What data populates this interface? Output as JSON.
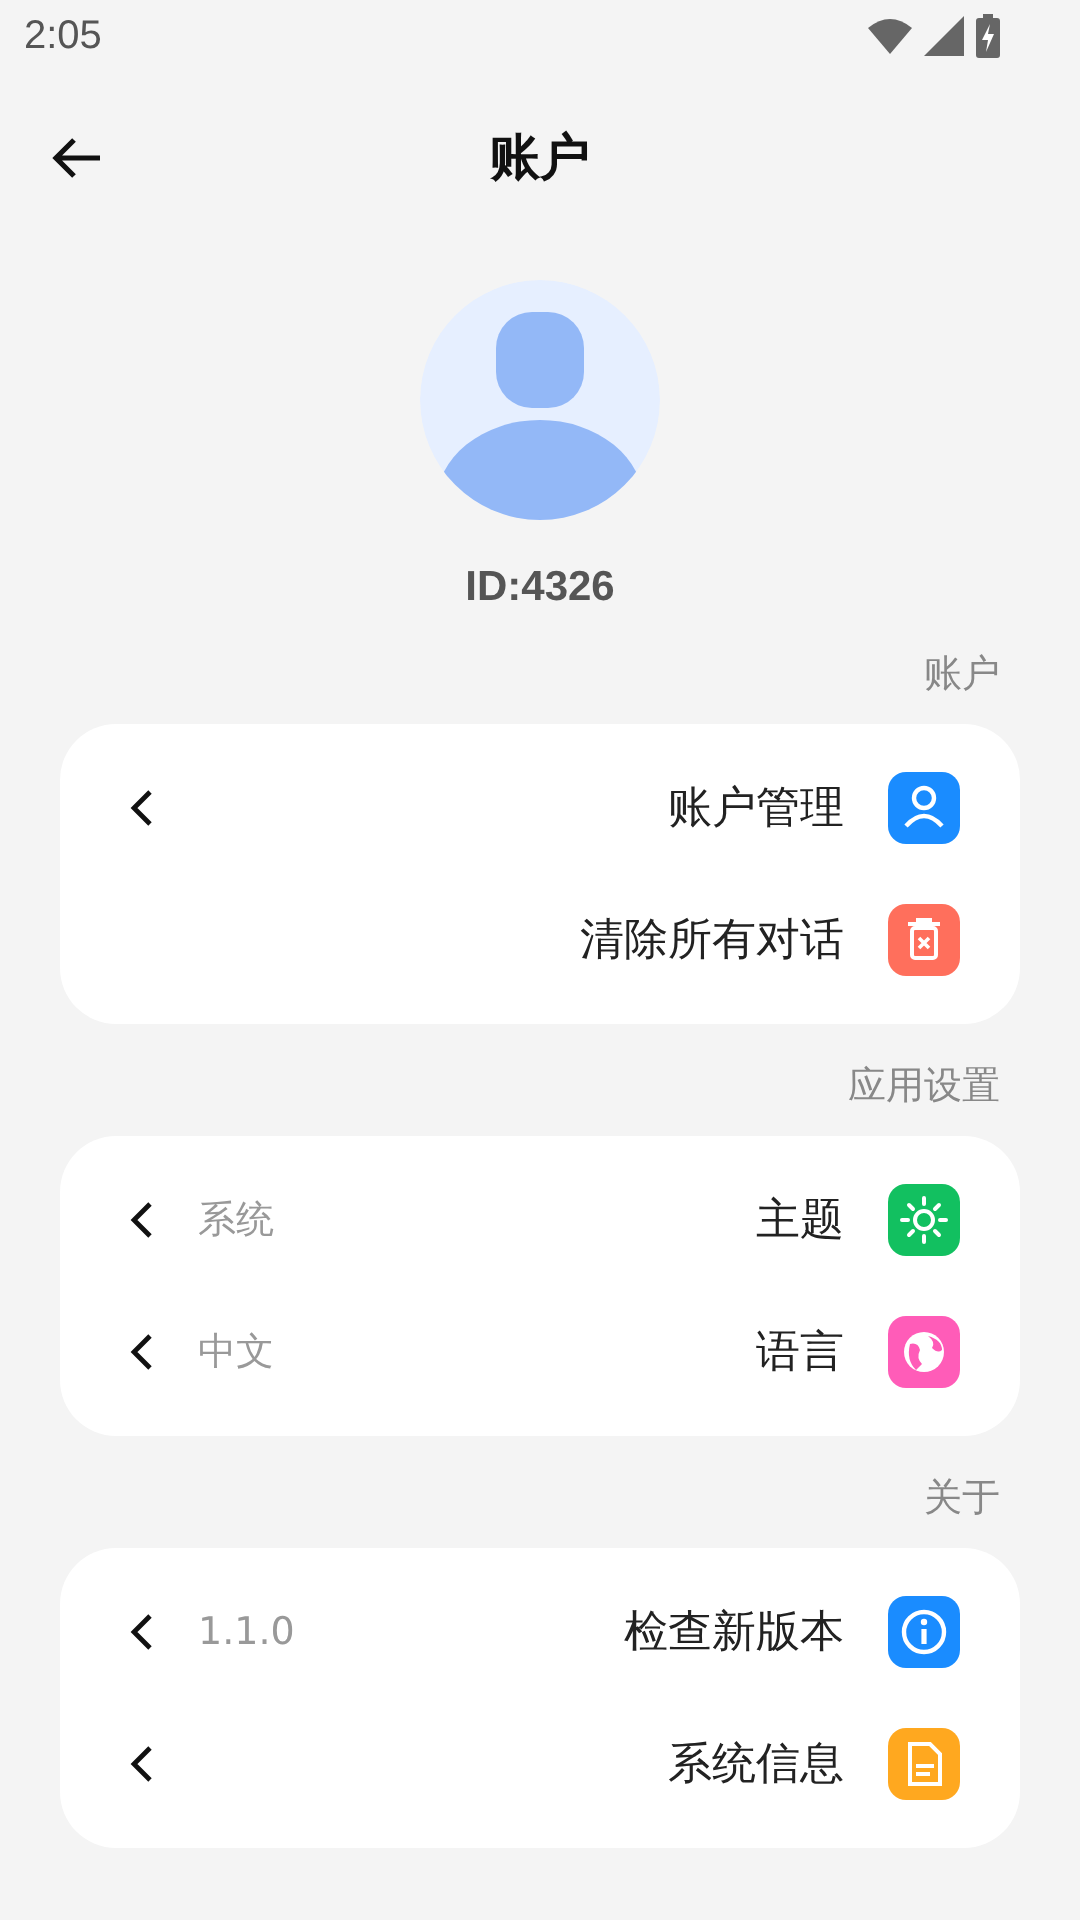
{
  "status_bar": {
    "time": "2:05"
  },
  "header": {
    "title": "账户"
  },
  "profile": {
    "id": "ID:4326"
  },
  "sections": [
    {
      "title": "账户",
      "items": [
        {
          "label": "账户管理",
          "chevron": true,
          "kind": "person",
          "color": "#1a8cff"
        },
        {
          "label": "清除所有对话",
          "chevron": false,
          "kind": "trash",
          "color": "#ff6f5c"
        }
      ]
    },
    {
      "title": "应用设置",
      "items": [
        {
          "label": "主题",
          "value": "系统",
          "chevron": true,
          "kind": "sun",
          "color": "#12c060"
        },
        {
          "label": "语言",
          "value": "中文",
          "chevron": true,
          "kind": "globe",
          "color": "#ff5cb8"
        }
      ]
    },
    {
      "title": "关于",
      "items": [
        {
          "label": "检查新版本",
          "value": "1.1.0",
          "chevron": true,
          "kind": "info",
          "color": "#1a8cff"
        },
        {
          "label": "系统信息",
          "chevron": true,
          "kind": "document",
          "color": "#ffa81f"
        }
      ]
    }
  ]
}
